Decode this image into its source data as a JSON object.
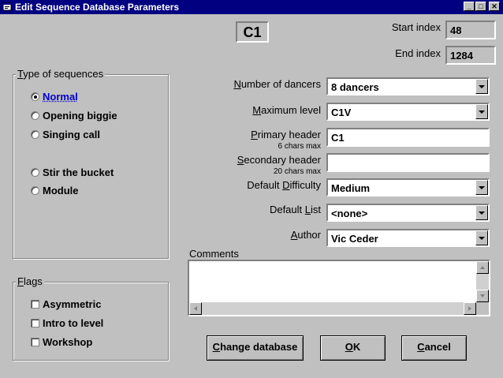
{
  "window": {
    "title": "Edit Sequence Database Parameters"
  },
  "header": {
    "level_code": "C1",
    "start_index_label": "Start index",
    "start_index_value": "48",
    "end_index_label": "End index",
    "end_index_value": "1284"
  },
  "type_group": {
    "legend_first": "T",
    "legend_rest": "ype of sequences",
    "options": [
      {
        "label": "Normal",
        "selected": true
      },
      {
        "label": "Opening biggie",
        "selected": false
      },
      {
        "label": "Singing call",
        "selected": false
      },
      {
        "label": "Stir the bucket",
        "selected": false
      },
      {
        "label": "Module",
        "selected": false
      }
    ]
  },
  "flags_group": {
    "legend_first": "F",
    "legend_rest": "lags",
    "options": [
      {
        "label": "Asymmetric",
        "checked": false
      },
      {
        "label": "Intro to level",
        "checked": false
      },
      {
        "label": "Workshop",
        "checked": false
      }
    ]
  },
  "form": {
    "dancers": {
      "key": "N",
      "label": "umber of dancers",
      "value": "8 dancers"
    },
    "max_level": {
      "key": "M",
      "label": "aximum level",
      "value": "C1V"
    },
    "primary": {
      "key": "P",
      "label": "rimary header",
      "sub": "6 chars max",
      "value": "C1"
    },
    "secondary": {
      "key": "S",
      "label": "econdary header",
      "sub": "20 chars max",
      "value": ""
    },
    "difficulty": {
      "pre": "Default ",
      "key": "D",
      "label": "ifficulty",
      "value": "Medium"
    },
    "list": {
      "pre": "Default ",
      "key": "L",
      "label": "ist",
      "value": "<none>"
    },
    "author": {
      "key": "A",
      "label": "uthor",
      "value": "Vic Ceder"
    },
    "comments": {
      "label": "Comments",
      "value": ""
    }
  },
  "buttons": {
    "change_key": "C",
    "change_rest": "hange database",
    "ok_key": "O",
    "ok_rest": "K",
    "cancel_key": "C",
    "cancel_rest": "ancel"
  },
  "colors": {
    "titlebar": "#000080",
    "face": "#c0c0c0",
    "selected_text": "#0000cc"
  }
}
